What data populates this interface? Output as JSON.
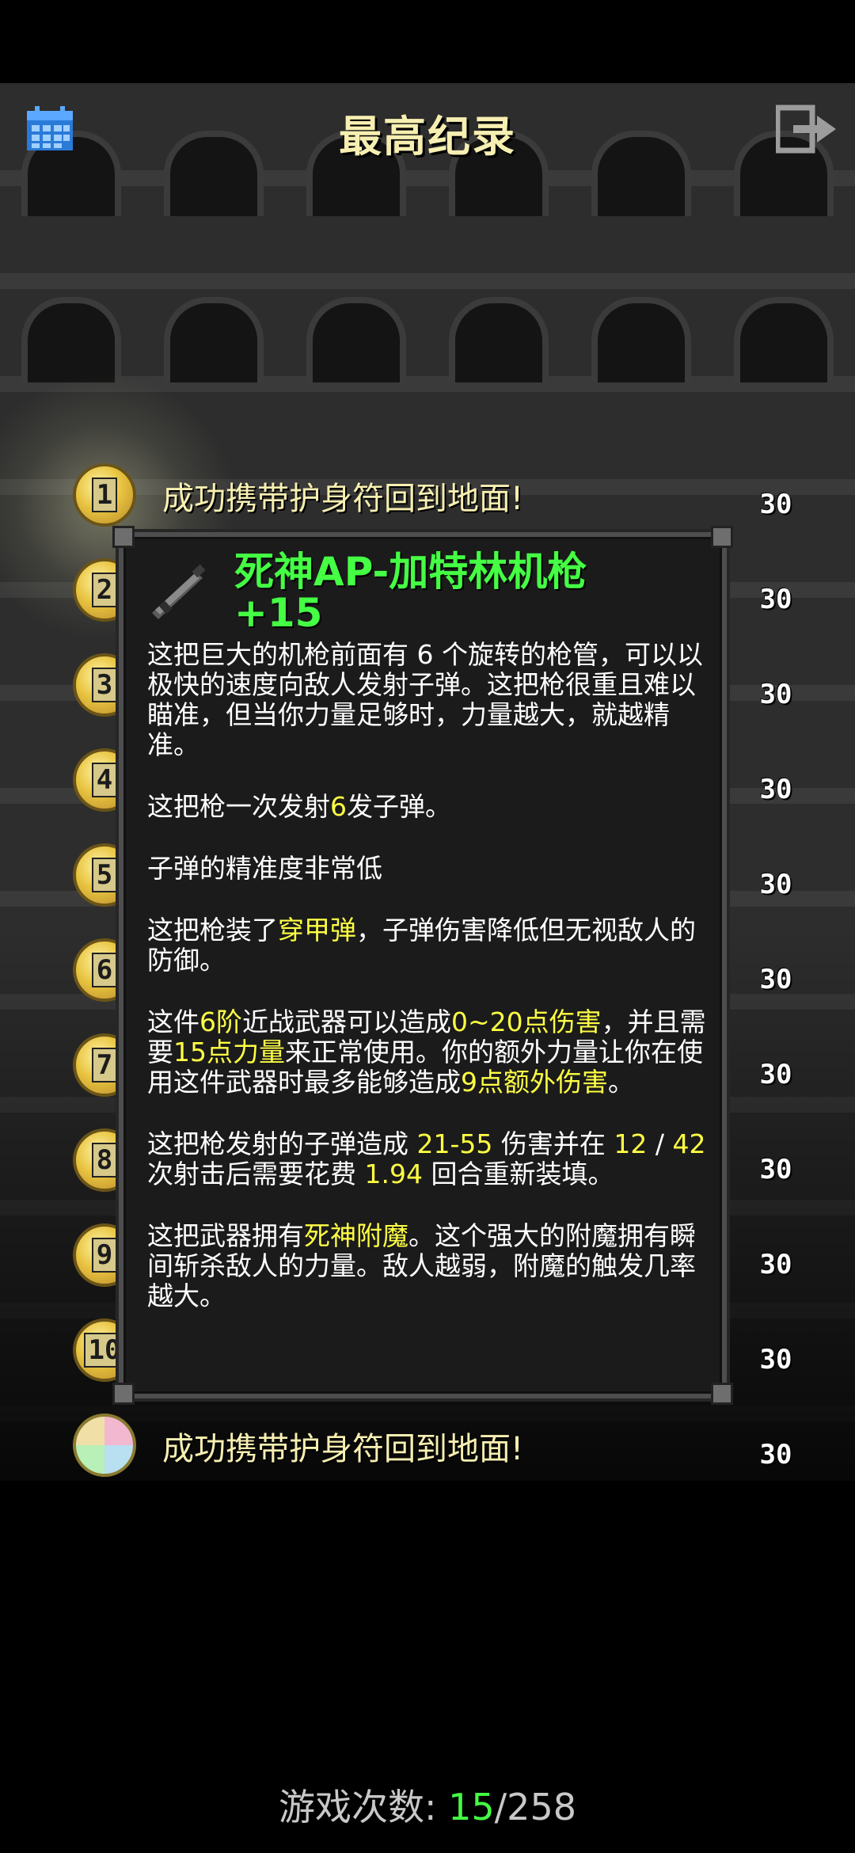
{
  "header": {
    "title": "最高纪录"
  },
  "rankings": [
    {
      "rank": "1",
      "text": "成功携带护身符回到地面!",
      "depth": "30"
    },
    {
      "rank": "2",
      "depth": "30"
    },
    {
      "rank": "3",
      "depth": "30"
    },
    {
      "rank": "4",
      "depth": "30"
    },
    {
      "rank": "5",
      "depth": "30"
    },
    {
      "rank": "6",
      "depth": "30"
    },
    {
      "rank": "7",
      "depth": "30"
    },
    {
      "rank": "8",
      "depth": "30"
    },
    {
      "rank": "9",
      "depth": "30"
    },
    {
      "rank": "10",
      "depth": "30"
    },
    {
      "rank": "",
      "text": "成功携带护身符回到地面!",
      "depth": "30"
    }
  ],
  "item": {
    "name_line1": "死神AP-加特林机枪",
    "name_line2": "+15",
    "p1": "这把巨大的机枪前面有 6 个旋转的枪管，可以以极快的速度向敌人发射子弹。这把枪很重且难以瞄准，但当你力量足够时，力量越大，就越精准。",
    "p2_a": "这把枪一次发射",
    "p2_b": "6",
    "p2_c": "发子弹。",
    "p3": "子弹的精准度非常低",
    "p4_a": "这把枪装了",
    "p4_b": "穿甲弹",
    "p4_c": "，子弹伤害降低但无视敌人的防御。",
    "p5_a": "这件",
    "p5_b": "6阶",
    "p5_c": "近战武器可以造成",
    "p5_d": "0~20点伤害",
    "p5_e": "，并且需要",
    "p5_f": "15点力量",
    "p5_g": "来正常使用。你的额外力量让你在使用这件武器时最多能够造成",
    "p5_h": "9点额外伤害",
    "p5_i": "。",
    "p6_a": "这把枪发射的子弹造成 ",
    "p6_b": "21-55",
    "p6_c": " 伤害并在 ",
    "p6_d": "12",
    "p6_e": " / ",
    "p6_f": "42",
    "p6_g": " 次射击后需要花费 ",
    "p6_h": "1.94",
    "p6_i": " 回合重新装填。",
    "p7_a": "这把武器拥有",
    "p7_b": "死神附魔",
    "p7_c": "。这个强大的附魔拥有瞬间斩杀敌人的力量。敌人越弱，附魔的触发几率越大。"
  },
  "footer": {
    "label": "游戏次数: ",
    "current": "15",
    "separator": "/",
    "total": "258"
  },
  "colors": {
    "title": "#f7efb1",
    "item_name": "#44ff44",
    "highlight": "#ffff44"
  }
}
